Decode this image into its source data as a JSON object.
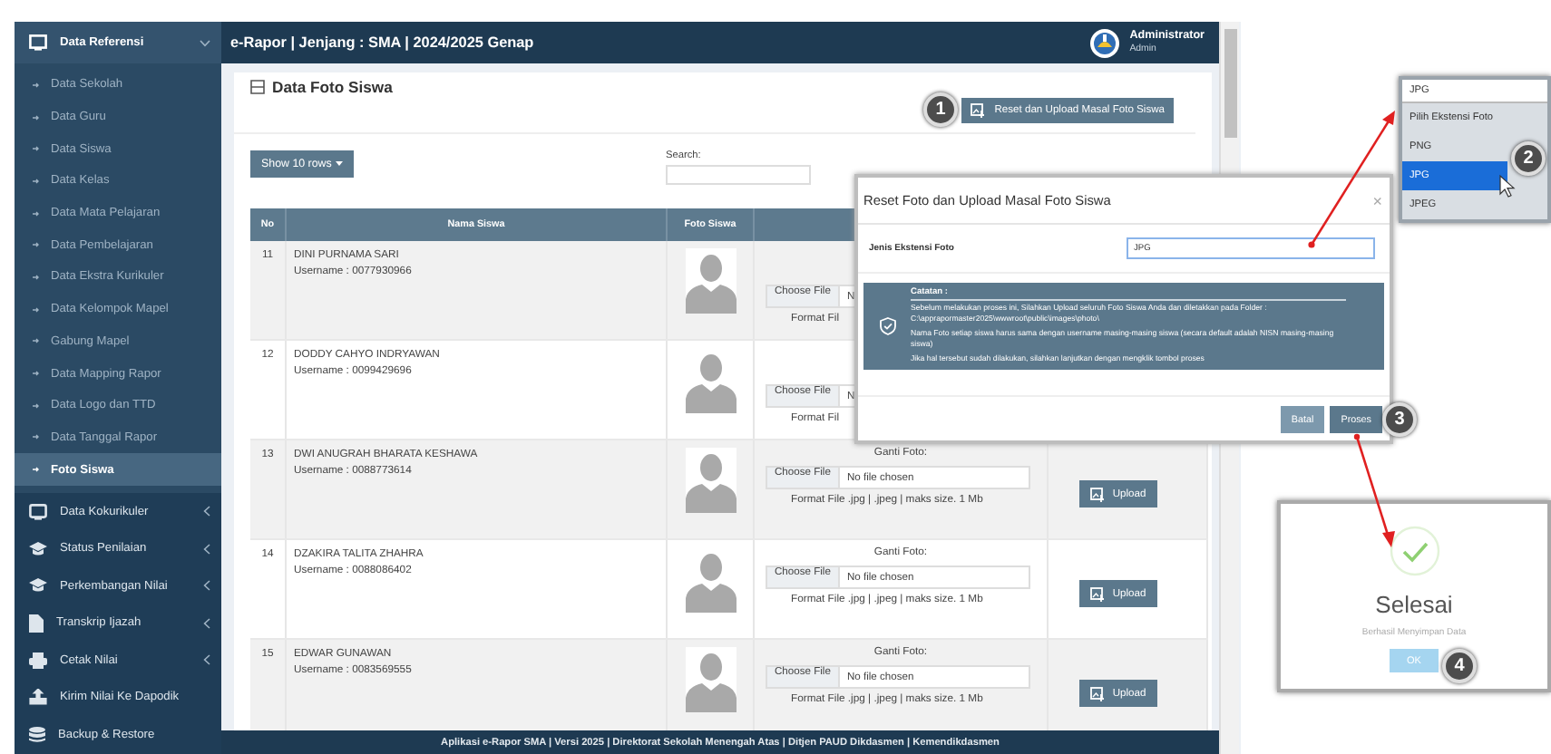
{
  "sidebar": {
    "items": [
      {
        "label": "Data Referensi",
        "expanded": true,
        "children": [
          {
            "label": "Data Sekolah",
            "selected": false
          },
          {
            "label": "Data Guru",
            "selected": false
          },
          {
            "label": "Data Siswa",
            "selected": false
          },
          {
            "label": "Data Kelas",
            "selected": false
          },
          {
            "label": "Data Mata Pelajaran",
            "selected": false
          },
          {
            "label": "Data Pembelajaran",
            "selected": false
          },
          {
            "label": "Data Ekstra Kurikuler",
            "selected": false
          },
          {
            "label": "Data Kelompok Mapel",
            "selected": false
          },
          {
            "label": "Gabung Mapel",
            "selected": false
          },
          {
            "label": "Data Mapping Rapor",
            "selected": false
          },
          {
            "label": "Data Logo dan TTD",
            "selected": false
          },
          {
            "label": "Data Tanggal Rapor",
            "selected": false
          },
          {
            "label": "Foto Siswa",
            "selected": true
          }
        ]
      },
      {
        "label": "Data Kokurikuler",
        "expanded": false
      },
      {
        "label": "Status Penilaian",
        "expanded": false
      },
      {
        "label": "Perkembangan Nilai",
        "expanded": false
      },
      {
        "label": "Transkrip Ijazah",
        "expanded": false
      },
      {
        "label": "Cetak Nilai",
        "expanded": false
      },
      {
        "label": "Kirim Nilai Ke Dapodik"
      },
      {
        "label": "Backup & Restore"
      }
    ]
  },
  "header": {
    "title": "e-Rapor | Jenjang : SMA | 2024/2025 Genap",
    "user_name": "Administrator",
    "user_role": "Admin"
  },
  "page": {
    "title": "Data Foto Siswa",
    "mass_upload_button": "Reset dan Upload Masal Foto Siswa",
    "rows_button": "Show 10 rows",
    "search_label": "Search:",
    "table": {
      "columns": [
        "No",
        "Nama Siswa",
        "Foto Siswa"
      ],
      "rows": [
        {
          "no": "11",
          "name": "DINI PURNAMA SARI",
          "username": "Username : 0077930966",
          "file_button": "Choose File",
          "file_status": "N",
          "format_note": "Format Fil"
        },
        {
          "no": "12",
          "name": "DODDY CAHYO INDRYAWAN",
          "username": "Username : 0099429696",
          "file_button": "Choose File",
          "file_status": "N",
          "format_note": "Format Fil"
        },
        {
          "no": "13",
          "name": "DWI ANUGRAH BHARATA KESHAWA",
          "username": "Username : 0088773614",
          "photo_label": "Ganti Foto:",
          "file_button": "Choose File",
          "file_status": "No file chosen",
          "format_note": "Format File .jpg | .jpeg | maks size. 1 Mb",
          "upload_button": "Upload"
        },
        {
          "no": "14",
          "name": "DZAKIRA TALITA ZHAHRA",
          "username": "Username : 0088086402",
          "photo_label": "Ganti Foto:",
          "file_button": "Choose File",
          "file_status": "No file chosen",
          "format_note": "Format File .jpg | .jpeg | maks size. 1 Mb",
          "upload_button": "Upload"
        },
        {
          "no": "15",
          "name": "EDWAR GUNAWAN",
          "username": "Username : 0083569555",
          "photo_label": "Ganti Foto:",
          "file_button": "Choose File",
          "file_status": "No file chosen",
          "format_note": "Format File .jpg | .jpeg | maks size. 1 Mb",
          "upload_button": "Upload"
        }
      ]
    }
  },
  "footer": "Aplikasi e-Rapor SMA | Versi 2025 | Direktorat Sekolah Menengah Atas | Ditjen PAUD Dikdasmen | Kemendikdasmen",
  "modal": {
    "title": "Reset Foto dan Upload Masal Foto Siswa",
    "close": "×",
    "field_label": "Jenis Ekstensi Foto",
    "field_value": "JPG",
    "note_title": "Catatan :",
    "note_lines": [
      "Sebelum melakukan proses ini, Silahkan Upload seluruh Foto Siswa Anda dan diletakkan pada Folder : C:\\apprapormaster2025\\wwwroot\\public\\images\\photo\\",
      "Nama Foto setiap siswa harus sama dengan username masing-masing siswa (secara default adalah NISN masing-masing siswa)",
      "Jika hal tersebut sudah dilakukan, silahkan lanjutkan dengan mengklik tombol proses"
    ],
    "buttons": [
      "Batal",
      "Proses"
    ]
  },
  "dropdown": {
    "value": "JPG",
    "options": [
      {
        "label": "Pilih Ekstensi Foto",
        "selected": false
      },
      {
        "label": "PNG",
        "selected": false
      },
      {
        "label": "JPG",
        "selected": true
      },
      {
        "label": "JPEG",
        "selected": false
      }
    ]
  },
  "success": {
    "title": "Selesai",
    "message": "Berhasil Menyimpan Data",
    "button": "OK"
  },
  "steps": [
    "1",
    "2",
    "3",
    "4"
  ]
}
